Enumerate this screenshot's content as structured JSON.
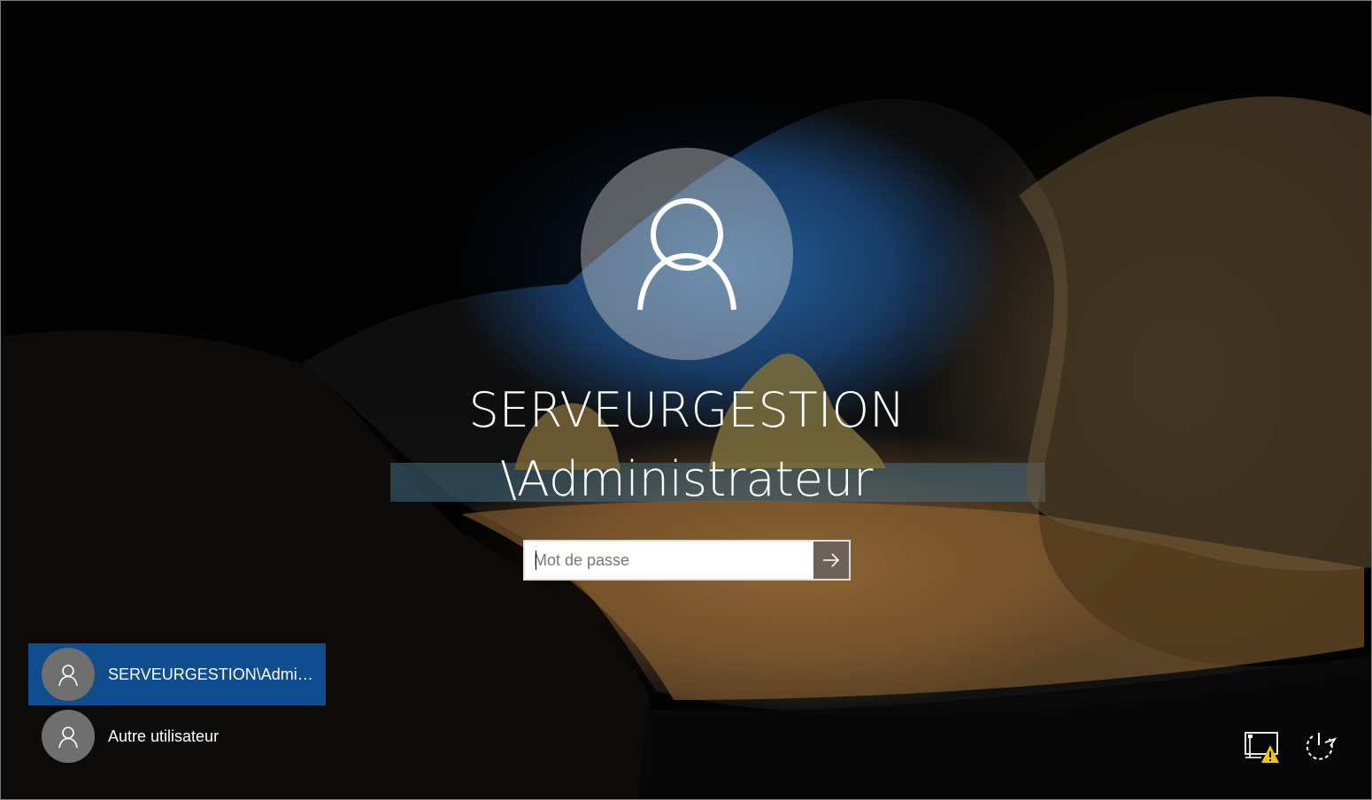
{
  "login": {
    "username_line1": "SERVEURGESTION",
    "username_line2": "\\Administrateur",
    "password_placeholder": "Mot de passe",
    "submit_icon": "arrow-right-icon"
  },
  "users": [
    {
      "label": "SERVEURGESTION\\Administrateur",
      "icon": "user-icon",
      "selected": true
    },
    {
      "label": "Autre utilisateur",
      "icon": "user-icon",
      "selected": false
    }
  ],
  "corner_icons": [
    "network-warning-icon",
    "power-icon"
  ],
  "colors": {
    "selected_user_bg": "#0f4d8f",
    "submit_bg": "#6d625a",
    "warning": "#f5c400"
  }
}
